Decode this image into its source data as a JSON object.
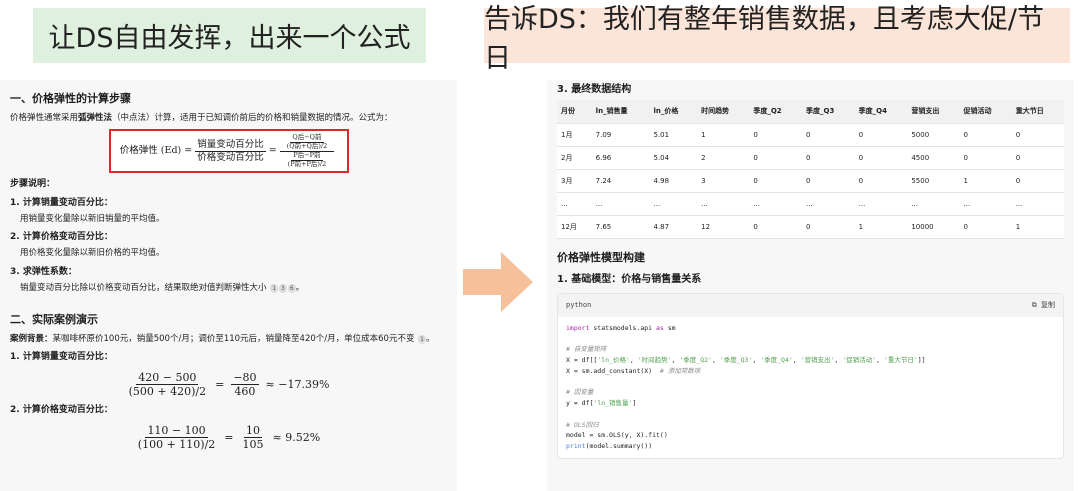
{
  "banners": {
    "left": "让DS自由发挥，出来一个公式",
    "right": "告诉DS：我们有整年销售数据，且考虑大促/节日"
  },
  "left": {
    "sec1_title": "一、价格弹性的计算步骤",
    "intro_pre": "价格弹性通常采用",
    "intro_bold": "弧弹性法",
    "intro_post": "（中点法）计算，适用于已知调价前后的价格和销量数据的情况。公式为：",
    "formula": {
      "lhs": "价格弹性 (Ed) =",
      "num": "销量变动百分比",
      "den": "价格变动百分比",
      "eq": "=",
      "q_num": "Q后−Q前",
      "q_den": "(Q前+Q后)/2",
      "p_num": "P后−P前",
      "p_den": "(P前+P后)/2"
    },
    "steps_label": "步骤说明：",
    "steps": [
      {
        "title": "1. 计算销量变动百分比：",
        "desc": "用销量变化量除以新旧销量的平均值。"
      },
      {
        "title": "2. 计算价格变动百分比：",
        "desc": "用价格变化量除以新旧价格的平均值。"
      },
      {
        "title": "3. 求弹性系数：",
        "desc": "销量变动百分比除以价格变动百分比，结果取绝对值判断弹性大小"
      }
    ],
    "step3_refs": [
      "1",
      "3",
      "6"
    ],
    "sec2_title": "二、实际案例演示",
    "case_label": "案例背景：",
    "case_text": "某咖啡杯原价100元，销量500个/月；调价至110元后，销量降至420个/月，单位成本60元不变",
    "case_ref": "1",
    "calc1_title": "1. 计算销量变动百分比：",
    "calc1": {
      "num": "420 − 500",
      "den": "(500 + 420)/2",
      "num2": "−80",
      "den2": "460",
      "result": "≈ −17.39%"
    },
    "calc2_title": "2. 计算价格变动百分比：",
    "calc2": {
      "num": "110 − 100",
      "den": "(100 + 110)/2",
      "num2": "10",
      "den2": "105",
      "result": "≈ 9.52%"
    }
  },
  "right": {
    "sec3_title": "3. 最终数据结构",
    "table": {
      "headers": [
        "月份",
        "ln_销售量",
        "ln_价格",
        "时间趋势",
        "季度_Q2",
        "季度_Q3",
        "季度_Q4",
        "营销支出",
        "促销活动",
        "重大节日"
      ],
      "rows": [
        [
          "1月",
          "7.09",
          "5.01",
          "1",
          "0",
          "0",
          "0",
          "5000",
          "0",
          "0"
        ],
        [
          "2月",
          "6.96",
          "5.04",
          "2",
          "0",
          "0",
          "0",
          "4500",
          "0",
          "0"
        ],
        [
          "3月",
          "7.24",
          "4.98",
          "3",
          "0",
          "0",
          "0",
          "5500",
          "1",
          "0"
        ],
        [
          "...",
          "...",
          "...",
          "...",
          "...",
          "...",
          "...",
          "...",
          "...",
          "..."
        ],
        [
          "12月",
          "7.65",
          "4.87",
          "12",
          "0",
          "0",
          "1",
          "10000",
          "0",
          "1"
        ]
      ]
    },
    "model_title": "价格弹性模型构建",
    "model_sub": "1. 基础模型：价格与销售量关系",
    "code": {
      "lang": "python",
      "copy": "复制",
      "lines": {
        "l1a": "import",
        "l1b": " statsmodels.api ",
        "l1c": "as",
        "l1d": " sm",
        "c1": "# 自变量矩阵",
        "l3a": "X = df[[",
        "l3b": "'ln_价格'",
        "l3c": ", ",
        "l3d": "'时间趋势'",
        "l3e": ", ",
        "l3f": "'季度_Q2'",
        "l3g": ", ",
        "l3h": "'季度_Q3'",
        "l3i": ", ",
        "l3j": "'季度_Q4'",
        "l3k": ", ",
        "l3l": "'营销支出'",
        "l3m": ", ",
        "l3n": "'促销活动'",
        "l3o": ", ",
        "l3p": "'重大节日'",
        "l3q": "]]",
        "l4a": "X = sm.add_constant(X)  ",
        "l4b": "# 添加常数项",
        "c2": "# 因变量",
        "l6a": "y = df[",
        "l6b": "'ln_销售量'",
        "l6c": "]",
        "c3": "# OLS回归",
        "l8": "model = sm.OLS(y, X).fit()",
        "l9a": "print",
        "l9b": "(model.summary())"
      }
    }
  },
  "colors": {
    "highlight_border": "#e0262b",
    "arrow": "#f6c09a",
    "left_banner": "#dff0de",
    "right_banner": "#fbe4d8"
  }
}
